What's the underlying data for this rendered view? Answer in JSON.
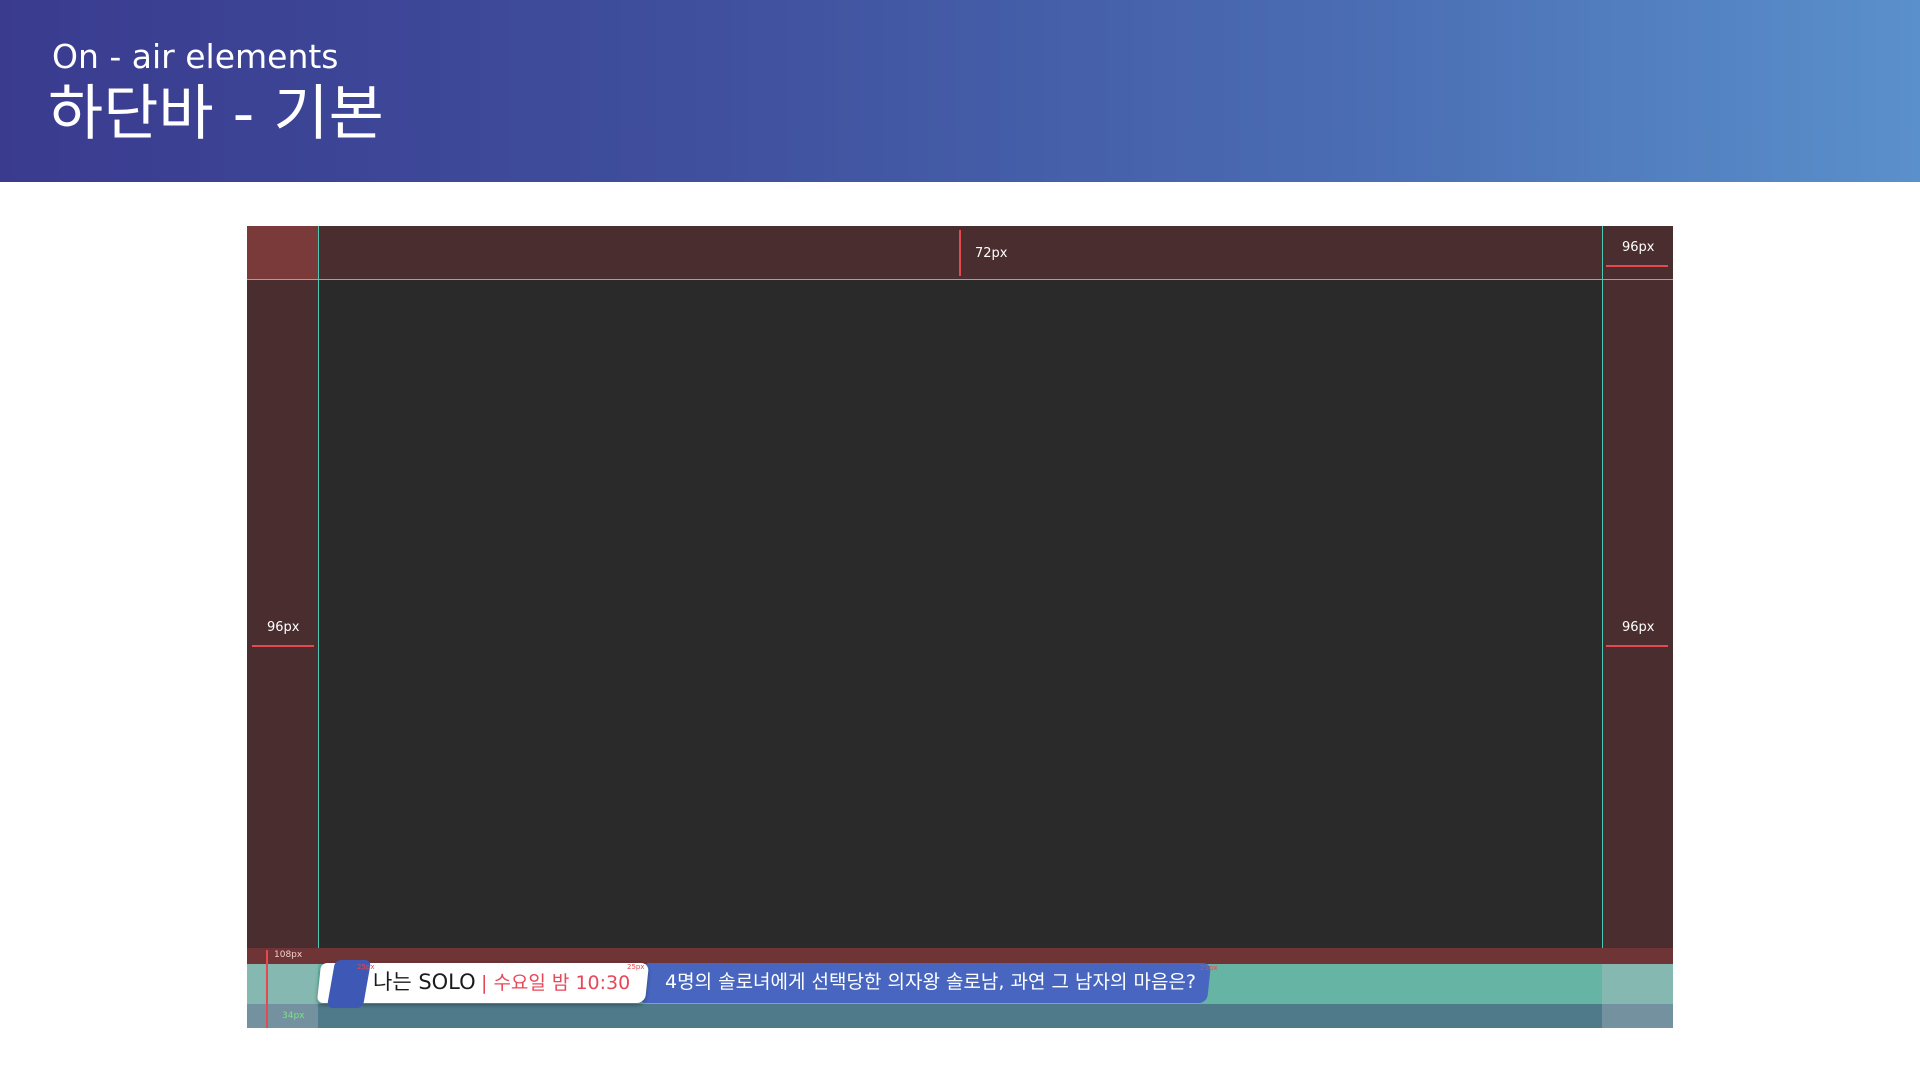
{
  "header": {
    "subtitle": "On - air elements",
    "title": "하단바 - 기본"
  },
  "guides": {
    "top_label": "72px",
    "top_right_label": "96px",
    "left_label": "96px",
    "right_label": "96px",
    "bottom_label": "108px",
    "bottom_small_label": "34px",
    "spacing_label": "25px"
  },
  "lower_third": {
    "show_name": "나는 SOLO",
    "airtime": "| 수요일 밤 10:30",
    "headline": "4명의 솔로녀에게 선택당한 의자왕 솔로남, 과연 그 남자의 마음은?"
  },
  "colors": {
    "header_gradient_start": "#3a3b8f",
    "header_gradient_end": "#5a90cc",
    "margin_overlay": "#4a2d2f",
    "safe_area": "#2a2a2a",
    "guide_line": "#4fc7b3",
    "measure_arrow": "#e5484d",
    "lower_band": "#66b5a4",
    "headline_bar": "#4866c0",
    "airtime_text": "#e8475a"
  }
}
